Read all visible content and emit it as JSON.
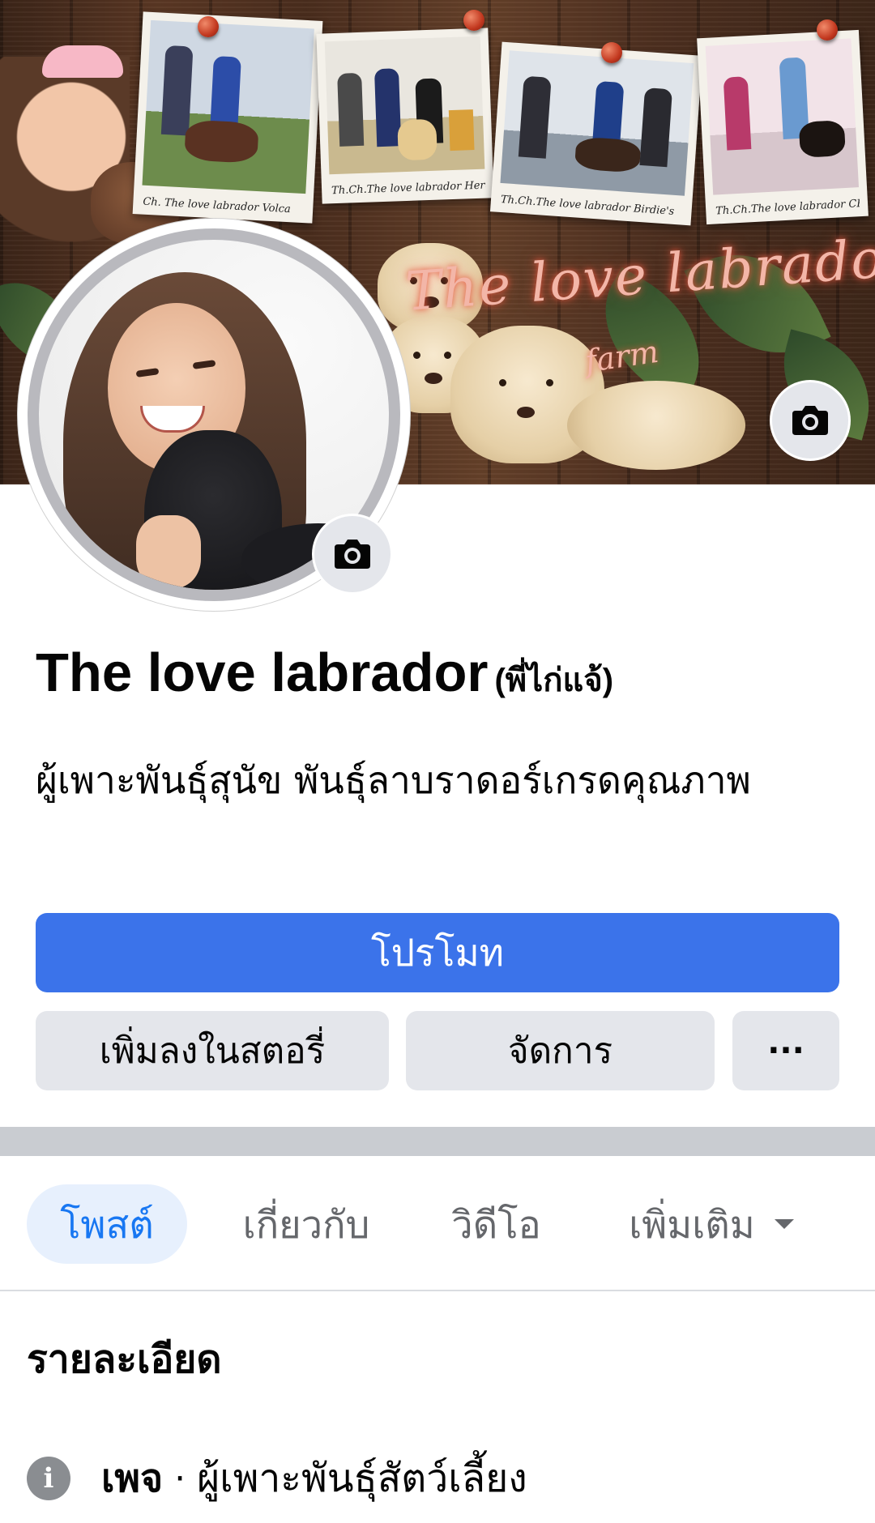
{
  "cover": {
    "title": "The love labrador",
    "subtitle": "farm",
    "photos": [
      {
        "caption": "Ch. The love labrador Volca"
      },
      {
        "caption": "Th.Ch.The love labrador Hercules"
      },
      {
        "caption": "Th.Ch.The love labrador Birdie's"
      },
      {
        "caption": "Th.Ch.The love labrador CHOPP"
      }
    ],
    "edit_icon": "camera-icon"
  },
  "avatar": {
    "edit_icon": "camera-icon"
  },
  "profile": {
    "name": "The love labrador",
    "nickname": "(พี่ไก่แจ้)",
    "description": "ผู้เพาะพันธุ์สุนัข พันธุ์ลาบราดอร์เกรดคุณภาพ"
  },
  "actions": {
    "promote": "โปรโมท",
    "add_to_story": "เพิ่มลงในสตอรี่",
    "manage": "จัดการ",
    "more": "···"
  },
  "tabs": [
    {
      "label": "โพสต์",
      "active": true
    },
    {
      "label": "เกี่ยวกับ",
      "active": false
    },
    {
      "label": "วิดีโอ",
      "active": false
    },
    {
      "label": "เพิ่มเติม",
      "active": false
    }
  ],
  "details": {
    "title": "รายละเอียด",
    "items": [
      {
        "icon": "info-icon",
        "label": "เพจ",
        "separator": "·",
        "value": "ผู้เพาะพันธุ์สัตว์เลี้ยง"
      }
    ]
  },
  "colors": {
    "primary_button": "#3b73ea",
    "secondary_button": "#e4e6eb",
    "active_tab_bg": "#e7f0fd",
    "active_tab_text": "#1877f2",
    "muted_text": "#65676b"
  }
}
